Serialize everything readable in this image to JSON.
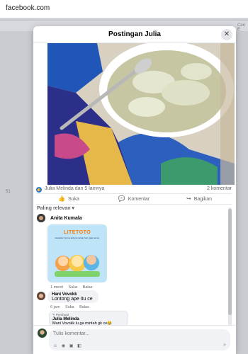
{
  "browser": {
    "url": "facebook.com"
  },
  "background": {
    "right_text": "Ceri E",
    "left_badge": "51"
  },
  "modal": {
    "title": "Postingan Julia",
    "close_label": "✕"
  },
  "post": {
    "reactions_text": "Julia Melinda dan 5 lainnya",
    "comment_count": "2 komentar",
    "actions": {
      "like": "Suka",
      "comment": "Komentar",
      "share": "Bagikan"
    }
  },
  "comments": {
    "sort_label": "Paling relevan",
    "items": [
      {
        "author": "Anita Kumala",
        "sticker_title": "LITETOTO",
        "sticker_sub": "dapatkan bonus jackpot setiap hari, ajak teman",
        "time": "1 menit",
        "like": "Suka",
        "reply": "Balas"
      },
      {
        "author": "Hani Vovokk",
        "text": "Lontong ape itu ce",
        "time": "6 jam",
        "like": "Suka",
        "reply": "Balas"
      }
    ],
    "reply_preview": {
      "tag": "Pembuat",
      "author": "Julia Melinda",
      "text": "Mani Vovokk lu ga mintah gk ce😂"
    }
  },
  "composer": {
    "placeholder": "Tulis komentar...",
    "icons": [
      "emoji-icon",
      "camera-icon",
      "gif-icon",
      "sticker-icon"
    ]
  }
}
